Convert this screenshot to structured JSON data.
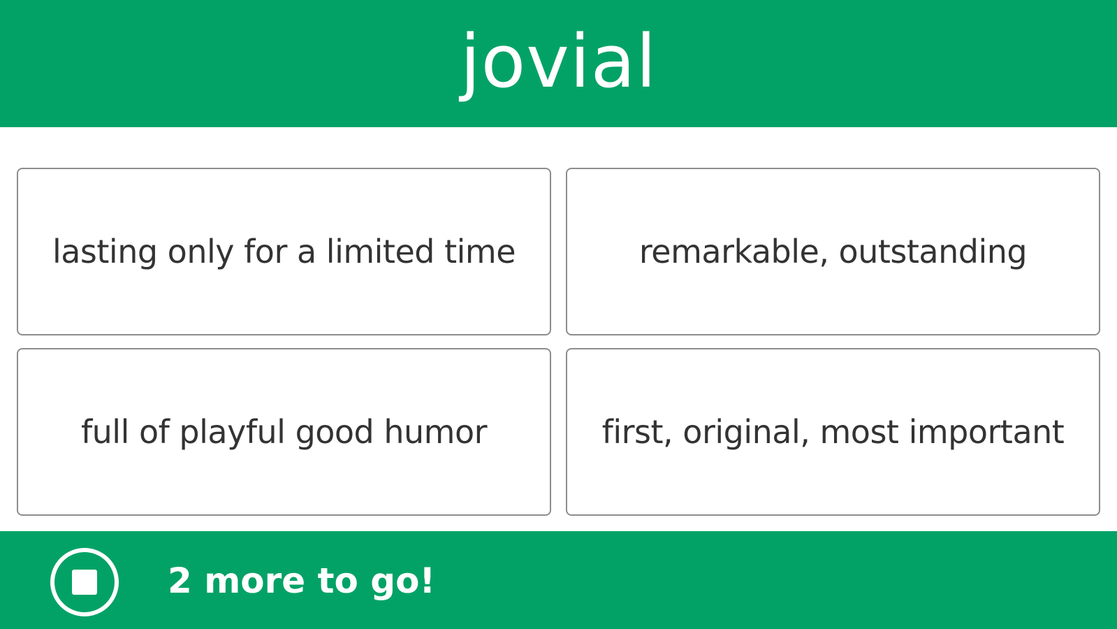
{
  "header": {
    "word": "jovial"
  },
  "choices": [
    {
      "label": "lasting only for a limited time"
    },
    {
      "label": "remarkable, outstanding"
    },
    {
      "label": "full of playful good humor"
    },
    {
      "label": "first, original, most important"
    }
  ],
  "footer": {
    "stop_icon": "stop-icon",
    "progress_text": "2 more to go!"
  },
  "colors": {
    "brand_green": "#02a266",
    "card_border": "#8d8d8d",
    "text_dark": "#333333"
  }
}
